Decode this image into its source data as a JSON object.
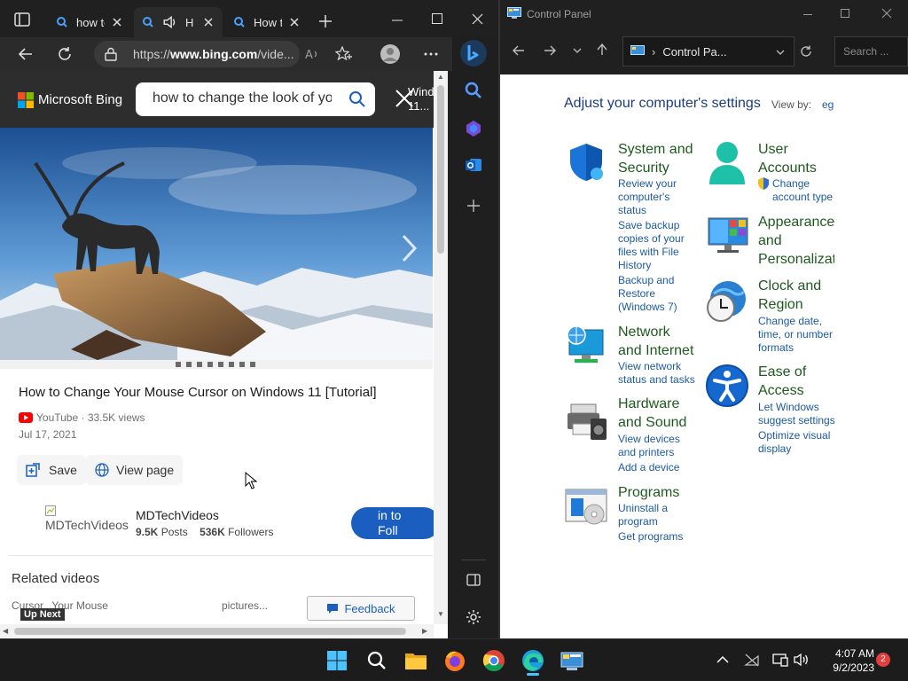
{
  "edge": {
    "tabs": [
      {
        "title": "how to"
      },
      {
        "title": "H"
      },
      {
        "title": "How to"
      }
    ],
    "address": {
      "prefix": "https://",
      "domain": "www.bing.com",
      "path": "/vide..."
    },
    "bing": {
      "brand": "Microsoft Bing",
      "search_value": "how to change the look of yo",
      "win_label_1": "Wind",
      "win_label_2": "11..."
    },
    "video": {
      "title": "How to Change Your Mouse Cursor on Windows 11 [Tutorial]",
      "source": "YouTube",
      "views": "33.5K views",
      "date": "Jul 17, 2021",
      "save_label": "Save",
      "view_page_label": "View page"
    },
    "channel": {
      "name": "MDTechVideos",
      "alt_text": "MDTechVideos",
      "posts_count": "9.5K",
      "posts_label": "Posts",
      "followers_count": "536K",
      "followers_label": "Followers",
      "follow_label_1": "in to",
      "follow_label_2": "Foll"
    },
    "related": {
      "heading": "Related videos",
      "up_next": "Up Next",
      "thumb1_text": "Cursor...Your Mouse",
      "thumb2_text": "pictures...",
      "feedback_label": "Feedback"
    }
  },
  "control_panel": {
    "window_title": "Control Panel",
    "breadcrumb": "Control Pa...",
    "search_placeholder": "Search ...",
    "heading": "Adjust your computer's settings",
    "view_by_label": "View by:",
    "view_by_value": "eg",
    "categories": {
      "system": {
        "title_1": "System and",
        "title_2": "Security",
        "links": [
          "Review your",
          "computer's",
          "status",
          "Save backup",
          "copies of your",
          "files with File",
          "History",
          "Backup and",
          "Restore",
          "(Windows 7)"
        ]
      },
      "network": {
        "title_1": "Network",
        "title_2": "and Internet",
        "links": [
          "View network",
          "status and tasks"
        ]
      },
      "hardware": {
        "title_1": "Hardware",
        "title_2": "and Sound",
        "links": [
          "View devices",
          "and printers",
          "Add a device"
        ]
      },
      "programs": {
        "title_1": "Programs",
        "links": [
          "Uninstall a",
          "program",
          "Get programs"
        ]
      },
      "users": {
        "title_1": "User",
        "title_2": "Accounts",
        "links": [
          "Change",
          "account type"
        ]
      },
      "appearance": {
        "title_1": "Appearance",
        "title_2": "and",
        "title_3": "Personalizati"
      },
      "clock": {
        "title_1": "Clock and",
        "title_2": "Region",
        "links": [
          "Change date,",
          "time, or number",
          "formats"
        ]
      },
      "ease": {
        "title_1": "Ease of",
        "title_2": "Access",
        "links": [
          "Let Windows",
          "suggest settings",
          "Optimize visual",
          "display"
        ]
      }
    }
  },
  "taskbar": {
    "time": "4:07 AM",
    "date": "9/2/2023",
    "notification_count": "2"
  },
  "colors": {
    "accent_blue": "#1a5fbf",
    "cp_link": "#1c5aa0",
    "cp_heading": "#1e5a1e",
    "edge_dark": "#202020"
  }
}
